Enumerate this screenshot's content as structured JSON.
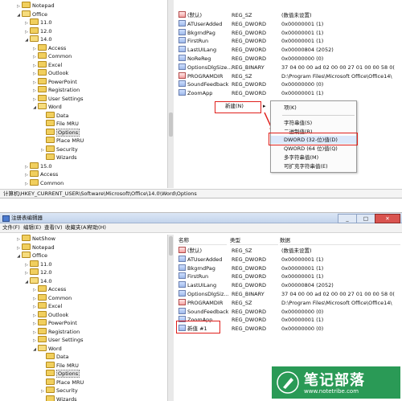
{
  "top": {
    "tree": [
      {
        "label": "Notepad",
        "indent": 3,
        "expander": "▷"
      },
      {
        "label": "Office",
        "indent": 3,
        "expander": "◢",
        "open": true
      },
      {
        "label": "11.0",
        "indent": 4,
        "expander": "▷"
      },
      {
        "label": "12.0",
        "indent": 4,
        "expander": "▷"
      },
      {
        "label": "14.0",
        "indent": 4,
        "expander": "◢",
        "open": true
      },
      {
        "label": "Access",
        "indent": 5,
        "expander": "▷"
      },
      {
        "label": "Common",
        "indent": 5,
        "expander": "▷"
      },
      {
        "label": "Excel",
        "indent": 5,
        "expander": "▷"
      },
      {
        "label": "Outlook",
        "indent": 5,
        "expander": "▷"
      },
      {
        "label": "PowerPoint",
        "indent": 5,
        "expander": "▷"
      },
      {
        "label": "Registration",
        "indent": 5,
        "expander": "▷"
      },
      {
        "label": "User Settings",
        "indent": 5,
        "expander": "▷"
      },
      {
        "label": "Word",
        "indent": 5,
        "expander": "◢",
        "open": true
      },
      {
        "label": "Data",
        "indent": 6,
        "expander": ""
      },
      {
        "label": "File MRU",
        "indent": 6,
        "expander": ""
      },
      {
        "label": "Options",
        "indent": 6,
        "expander": "",
        "selected": true
      },
      {
        "label": "Place MRU",
        "indent": 6,
        "expander": ""
      },
      {
        "label": "Security",
        "indent": 6,
        "expander": "▷"
      },
      {
        "label": "Wizards",
        "indent": 6,
        "expander": ""
      },
      {
        "label": "15.0",
        "indent": 4,
        "expander": "▷"
      },
      {
        "label": "Access",
        "indent": 4,
        "expander": "▷"
      },
      {
        "label": "Common",
        "indent": 4,
        "expander": "▷"
      }
    ],
    "values": [
      {
        "name": "(默认)",
        "type": "REG_SZ",
        "data": "(数值未设置)",
        "sz": true
      },
      {
        "name": "ATUserAdded",
        "type": "REG_DWORD",
        "data": "0x00000001 (1)"
      },
      {
        "name": "BkgrndPag",
        "type": "REG_DWORD",
        "data": "0x00000001 (1)"
      },
      {
        "name": "FirstRun",
        "type": "REG_DWORD",
        "data": "0x00000001 (1)"
      },
      {
        "name": "LastUILang",
        "type": "REG_DWORD",
        "data": "0x00000804 (2052)"
      },
      {
        "name": "NoReReg",
        "type": "REG_DWORD",
        "data": "0x00000000 (0)"
      },
      {
        "name": "OptionsDlgSize...",
        "type": "REG_BINARY",
        "data": "37 04 00 00 ad 02 00 00 27 01 00 00 58 0("
      },
      {
        "name": "PROGRAMDIR",
        "type": "REG_SZ",
        "data": "D:\\Program Files\\Microsoft Office\\Office14\\",
        "sz": true
      },
      {
        "name": "SoundFeedback",
        "type": "REG_DWORD",
        "data": "0x00000000 (0)"
      },
      {
        "name": "ZoomApp",
        "type": "REG_DWORD",
        "data": "0x00000001 (1)"
      }
    ],
    "new_button_label": "新建(N)",
    "submenu_arrow": "▸",
    "menu": [
      "项(K)",
      "字符串值(S)",
      "二进制值(B)",
      "DWORD (32-位)值(D)",
      "QWORD (64 位)值(Q)",
      "多字符串值(M)",
      "可扩充字符串值(E)"
    ],
    "status": "计算机\\HKEY_CURRENT_USER\\Software\\Microsoft\\Office\\14.0\\Word\\Options"
  },
  "bottom": {
    "title": "注册表编辑器",
    "menubar": [
      "文件(F)",
      "编辑(E)",
      "查看(V)",
      "收藏夹(A)",
      "帮助(H)"
    ],
    "columns": [
      "名称",
      "类型",
      "数据"
    ],
    "tree": [
      {
        "label": "NetShow",
        "indent": 3,
        "expander": "▷"
      },
      {
        "label": "Notepad",
        "indent": 3,
        "expander": "▷"
      },
      {
        "label": "Office",
        "indent": 3,
        "expander": "◢",
        "open": true
      },
      {
        "label": "11.0",
        "indent": 4,
        "expander": "▷"
      },
      {
        "label": "12.0",
        "indent": 4,
        "expander": "▷"
      },
      {
        "label": "14.0",
        "indent": 4,
        "expander": "◢",
        "open": true
      },
      {
        "label": "Access",
        "indent": 5,
        "expander": "▷"
      },
      {
        "label": "Common",
        "indent": 5,
        "expander": "▷"
      },
      {
        "label": "Excel",
        "indent": 5,
        "expander": "▷"
      },
      {
        "label": "Outlook",
        "indent": 5,
        "expander": "▷"
      },
      {
        "label": "PowerPoint",
        "indent": 5,
        "expander": "▷"
      },
      {
        "label": "Registration",
        "indent": 5,
        "expander": "▷"
      },
      {
        "label": "User Settings",
        "indent": 5,
        "expander": "▷"
      },
      {
        "label": "Word",
        "indent": 5,
        "expander": "◢",
        "open": true
      },
      {
        "label": "Data",
        "indent": 6,
        "expander": ""
      },
      {
        "label": "File MRU",
        "indent": 6,
        "expander": ""
      },
      {
        "label": "Options",
        "indent": 6,
        "expander": "",
        "selected": true
      },
      {
        "label": "Place MRU",
        "indent": 6,
        "expander": ""
      },
      {
        "label": "Security",
        "indent": 6,
        "expander": "▷"
      },
      {
        "label": "Wizards",
        "indent": 6,
        "expander": ""
      }
    ],
    "values": [
      {
        "name": "(默认)",
        "type": "REG_SZ",
        "data": "(数值未设置)",
        "sz": true
      },
      {
        "name": "ATUserAdded",
        "type": "REG_DWORD",
        "data": "0x00000001 (1)"
      },
      {
        "name": "BkgrndPag",
        "type": "REG_DWORD",
        "data": "0x00000001 (1)"
      },
      {
        "name": "FirstRun",
        "type": "REG_DWORD",
        "data": "0x00000001 (1)"
      },
      {
        "name": "LastUILang",
        "type": "REG_DWORD",
        "data": "0x00000804 (2052)"
      },
      {
        "name": "OptionsDlgSiz...",
        "type": "REG_BINARY",
        "data": "37 04 00 00 ad 02 00 00 27 01 00 00 58 0("
      },
      {
        "name": "PROGRAMDIR",
        "type": "REG_SZ",
        "data": "D:\\Program Files\\Microsoft Office\\Office14\\",
        "sz": true
      },
      {
        "name": "SoundFeedback",
        "type": "REG_DWORD",
        "data": "0x00000000 (0)"
      },
      {
        "name": "ZoomApp",
        "type": "REG_DWORD",
        "data": "0x00000001 (1)"
      },
      {
        "name": "新值 #1",
        "type": "REG_DWORD",
        "data": "0x00000000 (0)"
      }
    ]
  },
  "watermark": {
    "title": "笔记部落",
    "url": "www.notetribe.com"
  },
  "colors": {
    "highlight": "#e0201c",
    "selection": "#3399ff",
    "brand": "#2a9a56"
  }
}
